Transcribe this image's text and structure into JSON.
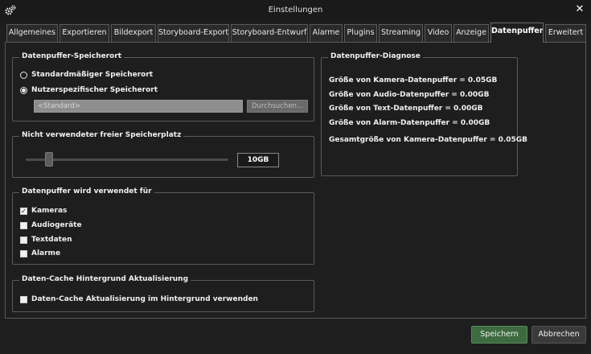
{
  "window": {
    "title": "Einstellungen",
    "close_glyph": "✕",
    "icon": "gears-icon"
  },
  "tabs": [
    {
      "label": "Allgemeines"
    },
    {
      "label": "Exportieren"
    },
    {
      "label": "Bildexport"
    },
    {
      "label": "Storyboard-Export"
    },
    {
      "label": "Storyboard-Entwurf"
    },
    {
      "label": "Alarme"
    },
    {
      "label": "Plugins"
    },
    {
      "label": "Streaming"
    },
    {
      "label": "Video"
    },
    {
      "label": "Anzeige"
    },
    {
      "label": "Datenpuffer",
      "active": true
    },
    {
      "label": "Erweitert"
    }
  ],
  "storage_location": {
    "title": "Datenpuffer-Speicherort",
    "option_default": "Standardmäßiger Speicherort",
    "option_custom": "Nutzerspezifischer Speicherort",
    "selected": "custom",
    "path_value": "<Standard>",
    "browse_label": "Durchsuchen..."
  },
  "free_space": {
    "title": "Nicht verwendeter freier Speicherplatz",
    "value": "10GB",
    "slider_level": 0.11
  },
  "usage": {
    "title": "Datenpuffer wird verwendet für",
    "items": [
      {
        "label": "Kameras",
        "checked": true
      },
      {
        "label": "Audiogeräte",
        "checked": false
      },
      {
        "label": "Textdaten",
        "checked": false
      },
      {
        "label": "Alarme",
        "checked": false
      }
    ]
  },
  "cache": {
    "title": "Daten-Cache Hintergrund Aktualisierung",
    "option": "Daten-Cache Aktualisierung im Hintergrund verwenden",
    "checked": false
  },
  "diagnostics": {
    "title": "Datenpuffer-Diagnose",
    "lines": [
      "Größe von Kamera-Datenpuffer = 0.05GB",
      "Größe von Audio-Datenpuffer = 0.00GB",
      "Größe von Text-Datenpuffer = 0.00GB",
      "Größe von Alarm-Datenpuffer = 0.00GB"
    ],
    "total": "Gesamtgröße von Kamera-Datenpuffer = 0.05GB"
  },
  "footer": {
    "save_label": "Speichern",
    "cancel_label": "Abbrechen"
  },
  "colors": {
    "background": "#1e1e1e",
    "save_button": "#3d6b3f",
    "border": "#5a5a5a"
  }
}
